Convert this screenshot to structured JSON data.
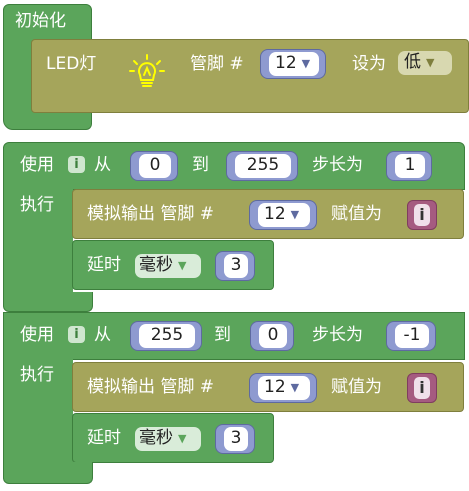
{
  "init_block": {
    "title": "初始化",
    "led_label": "LED灯",
    "pin_label": "管脚 #",
    "pin_value": "12",
    "set_label": "设为",
    "level_value": "低"
  },
  "loops": [
    {
      "use_label": "使用",
      "var": "i",
      "from_label": "从",
      "from_value": "0",
      "to_label": "到",
      "to_value": "255",
      "step_label": "步长为",
      "step_value": "1",
      "do_label": "执行",
      "analog_label": "模拟输出 管脚 #",
      "analog_pin": "12",
      "assign_label": "赋值为",
      "assign_var": "i",
      "delay_label": "延时",
      "delay_unit": "毫秒",
      "delay_value": "3"
    },
    {
      "use_label": "使用",
      "var": "i",
      "from_label": "从",
      "from_value": "255",
      "to_label": "到",
      "to_value": "0",
      "step_label": "步长为",
      "step_value": "-1",
      "do_label": "执行",
      "analog_label": "模拟输出 管脚 #",
      "analog_pin": "12",
      "assign_label": "赋值为",
      "assign_var": "i",
      "delay_label": "延时",
      "delay_unit": "毫秒",
      "delay_value": "3"
    }
  ],
  "icons": {
    "led": "led-bulb-icon",
    "dropdown": "triangle-down-icon"
  },
  "colors": {
    "control": "#5ba55b",
    "output": "#a5a55b",
    "number": "#8e9ad0",
    "variable": "#a55b80",
    "led": "#ffff00"
  }
}
